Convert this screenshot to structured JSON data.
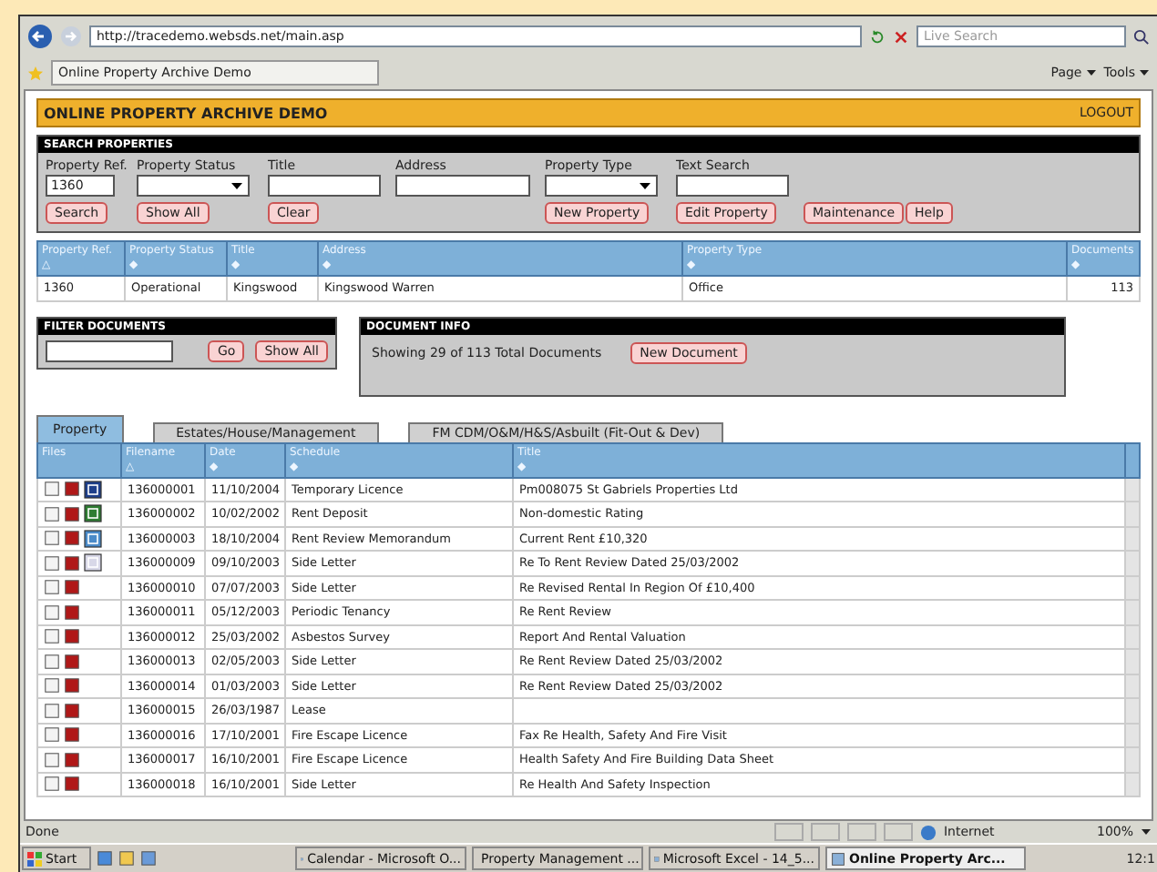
{
  "browser": {
    "address": "http://tracedemo.websds.net/main.asp",
    "search_placeholder": "Live Search",
    "tab_title": "Online Property Archive Demo",
    "commands": [
      "Page",
      "Tools"
    ]
  },
  "app": {
    "title": "ONLINE PROPERTY ARCHIVE DEMO",
    "logout": "LOGOUT"
  },
  "search": {
    "heading": "SEARCH PROPERTIES",
    "fields": [
      {
        "label": "Property Ref.",
        "kind": "text",
        "value": "1360"
      },
      {
        "label": "Property Status",
        "kind": "select"
      },
      {
        "label": "Title",
        "kind": "text"
      },
      {
        "label": "Address",
        "kind": "text"
      },
      {
        "label": "Property Type",
        "kind": "select"
      },
      {
        "label": "Text Search",
        "kind": "text"
      }
    ],
    "buttons": [
      "Search",
      "Show All",
      "Clear",
      "New Property",
      "Edit Property",
      "Maintenance",
      "Help"
    ]
  },
  "properties": {
    "columns": [
      {
        "label": "Property Ref.",
        "sort": "△"
      },
      {
        "label": "Property Status",
        "sort": "◆"
      },
      {
        "label": "Title",
        "sort": "◆"
      },
      {
        "label": "Address",
        "sort": "◆"
      },
      {
        "label": "Property Type",
        "sort": "◆"
      },
      {
        "label": "Documents",
        "sort": "◆"
      }
    ],
    "rows": [
      [
        "1360",
        "Operational",
        "Kingswood",
        "Kingswood Warren",
        "Office",
        "113"
      ]
    ]
  },
  "filter": {
    "heading": "FILTER DOCUMENTS",
    "buttons": [
      "Go",
      "Show All"
    ]
  },
  "info": {
    "heading": "DOCUMENT INFO",
    "text": "Showing 29 of 113 Total Documents",
    "button": "New Document"
  },
  "tabs": [
    {
      "label": "Property",
      "selected": true
    },
    {
      "label": "Estates/House/Management",
      "selected": false
    },
    {
      "label": "FM CDM/O&M/H&S/Asbuilt (Fit-Out & Dev)",
      "selected": false
    }
  ],
  "documents": {
    "columns": [
      {
        "label": "Files"
      },
      {
        "label": "Filename",
        "sort": "△"
      },
      {
        "label": "Date",
        "sort": "◆"
      },
      {
        "label": "Schedule",
        "sort": "◆"
      },
      {
        "label": "Title",
        "sort": "◆"
      }
    ],
    "rows": [
      {
        "kind": "word",
        "filename": "136000001",
        "date": "11/10/2004",
        "schedule": "Temporary Licence",
        "title": "Pm008075 St Gabriels Properties Ltd"
      },
      {
        "kind": "excel",
        "filename": "136000002",
        "date": "10/02/2002",
        "schedule": "Rent Deposit",
        "title": "Non-domestic Rating"
      },
      {
        "kind": "outlook",
        "filename": "136000003",
        "date": "18/10/2004",
        "schedule": "Rent Review Memorandum",
        "title": "Current Rent £10,320"
      },
      {
        "kind": "image",
        "filename": "136000009",
        "date": "09/10/2003",
        "schedule": "Side Letter",
        "title": "Re To Rent Review Dated 25/03/2002"
      },
      {
        "kind": "plain",
        "filename": "136000010",
        "date": "07/07/2003",
        "schedule": "Side Letter",
        "title": "Re Revised Rental In Region Of £10,400"
      },
      {
        "kind": "plain",
        "filename": "136000011",
        "date": "05/12/2003",
        "schedule": "Periodic Tenancy",
        "title": "Re Rent Review"
      },
      {
        "kind": "plain",
        "filename": "136000012",
        "date": "25/03/2002",
        "schedule": "Asbestos Survey",
        "title": "Report And Rental Valuation"
      },
      {
        "kind": "plain",
        "filename": "136000013",
        "date": "02/05/2003",
        "schedule": "Side Letter",
        "title": "Re Rent Review Dated 25/03/2002"
      },
      {
        "kind": "plain",
        "filename": "136000014",
        "date": "01/03/2003",
        "schedule": "Side Letter",
        "title": "Re Rent Review Dated 25/03/2002"
      },
      {
        "kind": "plain",
        "filename": "136000015",
        "date": "26/03/1987",
        "schedule": "Lease",
        "title": ""
      },
      {
        "kind": "plain",
        "filename": "136000016",
        "date": "17/10/2001",
        "schedule": "Fire Escape Licence",
        "title": "Fax Re Health, Safety And Fire Visit"
      },
      {
        "kind": "plain",
        "filename": "136000017",
        "date": "16/10/2001",
        "schedule": "Fire Escape Licence",
        "title": "Health Safety And Fire Building Data Sheet"
      },
      {
        "kind": "plain",
        "filename": "136000018",
        "date": "16/10/2001",
        "schedule": "Side Letter",
        "title": "Re Health And Safety Inspection"
      }
    ]
  },
  "status_bar": {
    "text": "Done",
    "zone": "Internet",
    "zoom": "100%"
  },
  "taskbar": {
    "start": "Start",
    "tasks": [
      {
        "label": "Calendar - Microsoft O...",
        "selected": false
      },
      {
        "label": "Property Management ...",
        "selected": false
      },
      {
        "label": "Microsoft Excel - 14_5...",
        "selected": false
      },
      {
        "label": "Online Property Arc...",
        "selected": true
      }
    ],
    "clock": "12:1"
  }
}
